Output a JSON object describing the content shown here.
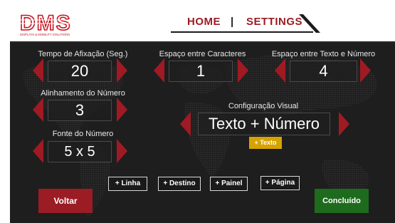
{
  "header": {
    "logo_text": "DMS",
    "logo_tagline": "DISPLAYS & MOBILITY SOLUTIONS",
    "nav_home": "HOME",
    "nav_separator": "|",
    "nav_settings": "SETTINGS"
  },
  "settings": {
    "tempo": {
      "label": "Tempo de Afixação (Seg.)",
      "value": "20"
    },
    "espaco_caracteres": {
      "label": "Espaço entre Caracteres",
      "value": "1"
    },
    "espaco_texto_numero": {
      "label": "Espaço entre Texto e Número",
      "value": "4"
    },
    "alinhamento": {
      "label": "Alinhamento do Número",
      "value": "3"
    },
    "fonte": {
      "label": "Fonte do Número",
      "value": "5 x 5"
    },
    "config_visual": {
      "label": "Configuração Visual",
      "value": "Texto + Número"
    }
  },
  "buttons": {
    "mais_texto": "+ Texto",
    "mais_linha": "+ Linha",
    "mais_destino": "+ Destino",
    "mais_painel": "+ Painel",
    "mais_pagina": "+ Página",
    "voltar": "Voltar",
    "concluido": "Concluído"
  },
  "colors": {
    "brand_red": "#9b1c24",
    "arrow_red": "#a01a24",
    "accent_yellow": "#d6a300",
    "confirm_green": "#1e6b1e",
    "panel_bg": "#1e1e1e"
  }
}
